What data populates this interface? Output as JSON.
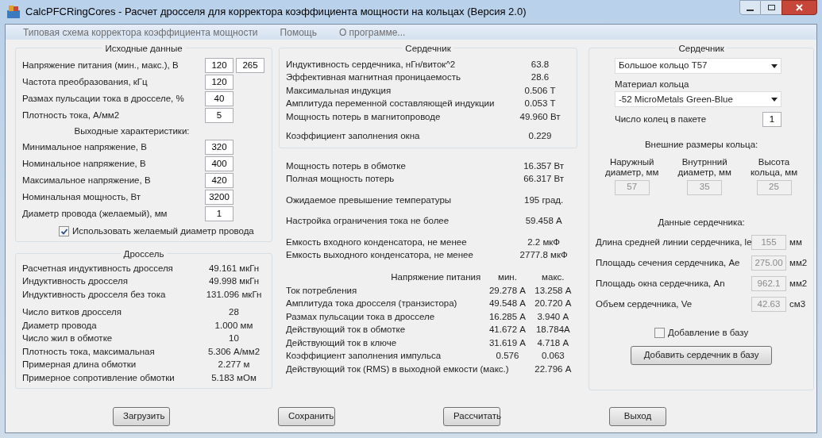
{
  "window": {
    "title": "CalcPFCRingCores - Расчет дросселя для корректора коэффициента мощности на кольцах (Версия 2.0)"
  },
  "menu": [
    "Типовая схема корректора коэффициента мощности",
    "Помощь",
    "О программе..."
  ],
  "input_data": {
    "title": "Исходные данные",
    "rows": [
      {
        "label": "Напряжение питания (мин.,  макс.), В",
        "values": [
          "120",
          "265"
        ]
      },
      {
        "label": "Частота преобразования, кГц",
        "values": [
          "120"
        ]
      },
      {
        "label": "Размах пульсации тока в дросселе, %",
        "values": [
          "40"
        ]
      },
      {
        "label": "Плотность тока, А/мм2",
        "values": [
          "5"
        ]
      }
    ],
    "subtitle": "Выходные характеристики:",
    "output_rows": [
      {
        "label": "Минимальное напряжение, В",
        "values": [
          "320"
        ]
      },
      {
        "label": "Номинальное напряжение, В",
        "values": [
          "400"
        ]
      },
      {
        "label": "Максимальное напряжение, В",
        "values": [
          "420"
        ]
      },
      {
        "label": "Номинальная мощность, Вт",
        "values": [
          "3200"
        ]
      },
      {
        "label": "Диаметр провода (желаемый), мм",
        "values": [
          "1"
        ]
      }
    ],
    "checkbox": {
      "label": "Использовать желаемый диаметр провода",
      "checked": true
    }
  },
  "choke": {
    "title": "Дроссель",
    "sections": [
      [
        {
          "label": "Расчетная индуктивность дросселя",
          "value": "49.161 мкГн"
        },
        {
          "label": "Индуктивность дросселя",
          "value": "49.998 мкГн"
        },
        {
          "label": "Индуктивность дросселя без тока",
          "value": "131.096 мкГн"
        }
      ],
      [
        {
          "label": "Число витков дросселя",
          "value": "28"
        },
        {
          "label": "Диаметр провода",
          "value": "1.000 мм"
        },
        {
          "label": "Число жил в обмотке",
          "value": "10"
        },
        {
          "label": "Плотность тока, максимальная",
          "value": "5.306 А/мм2"
        },
        {
          "label": "Примерная длина обмотки",
          "value": "2.277 м"
        },
        {
          "label": "Примерное сопротивление обмотки",
          "value": "5.183 мОм"
        }
      ]
    ]
  },
  "core_results": {
    "title": "Сердечник",
    "sections": [
      [
        {
          "label": "Индуктивность сердечника, нГн/виток^2",
          "value": "63.8"
        },
        {
          "label": "Эффективная магнитная проницаемость",
          "value": "28.6"
        },
        {
          "label": "Максимальная индукция",
          "value": "0.506 Т"
        },
        {
          "label": "Амплитуда переменной составляющей индукции",
          "value": "0.053 Т"
        },
        {
          "label": "Мощность потерь в магнитопроводе",
          "value": "49.960 Вт"
        }
      ],
      [
        {
          "label": "Коэффициент заполнения окна",
          "value": "0.229"
        }
      ]
    ]
  },
  "loss_sections": [
    [
      {
        "label": "Мощность потерь в обмотке",
        "value": "16.357 Вт"
      },
      {
        "label": "Полная мощность потерь",
        "value": "66.317 Вт"
      }
    ],
    [
      {
        "label": "Ожидаемое превышение температуры",
        "value": "195 град."
      }
    ],
    [
      {
        "label": "Настройка ограничения тока не более",
        "value": "59.458 А"
      }
    ],
    [
      {
        "label": "Емкость входного конденсатора, не менее",
        "value": "2.2 мкФ"
      },
      {
        "label": "Емкость выходного конденсатора, не менее",
        "value": "2777.8 мкФ"
      }
    ]
  ],
  "currents": {
    "header": {
      "label": "Напряжение питания",
      "min": "мин.",
      "max": "макс."
    },
    "rows": [
      {
        "label": "Ток потребления",
        "min": "29.278 А",
        "max": "13.258 А"
      },
      {
        "label": "Амплитуда тока дросселя (транзистора)",
        "min": "49.548 А",
        "max": "20.720 А"
      },
      {
        "label": "Размах пульсации тока в дросселе",
        "min": "16.285 А",
        "max": "3.940 А"
      },
      {
        "label": "Действующий ток в обмотке",
        "min": "41.672 А",
        "max": "18.784А"
      },
      {
        "label": "Действующий ток в ключе",
        "min": "31.619 А",
        "max": "4.718 А"
      },
      {
        "label": "Коэффициент заполнения импульса",
        "min": "0.576",
        "max": "0.063"
      },
      {
        "label": "Действующий ток (RMS) в выходной емкости (макс.)",
        "max": "22.796 А"
      }
    ]
  },
  "core_select": {
    "title": "Сердечник",
    "core_type": "Большое кольцо T57",
    "material_label": "Материал кольца",
    "material": "-52 MicroMetals Green-Blue",
    "rings_label": "Число колец в пакете",
    "rings": "1",
    "dims_title": "Внешние размеры кольца:",
    "dims": [
      {
        "label": "Наружный\nдиаметр, мм",
        "value": "57",
        "disabled": true
      },
      {
        "label": "Внутрнний\nдиаметр, мм",
        "value": "35",
        "disabled": true
      },
      {
        "label": "Высота\nкольца, мм",
        "value": "25",
        "disabled": true
      }
    ],
    "data_title": "Данные сердечника:",
    "data_rows": [
      {
        "label": "Длина средней линии сердечника, le",
        "value": "155",
        "unit": "мм",
        "disabled": true
      },
      {
        "label": "Площадь сечения сердечника, Ae",
        "value": "275.00",
        "unit": "мм2",
        "disabled": true
      },
      {
        "label": "Площадь окна сердечника, An",
        "value": "962.1",
        "unit": "мм2",
        "disabled": true
      },
      {
        "label": "Объем сердечника, Ve",
        "value": "42.63",
        "unit": "см3",
        "disabled": true
      }
    ],
    "add_checkbox": {
      "label": "Добавление в базу",
      "checked": false
    },
    "add_button": "Добавить сердечник в базу"
  },
  "buttons": [
    "Загрузить",
    "Сохранить",
    "Рассчитать",
    "Выход"
  ]
}
